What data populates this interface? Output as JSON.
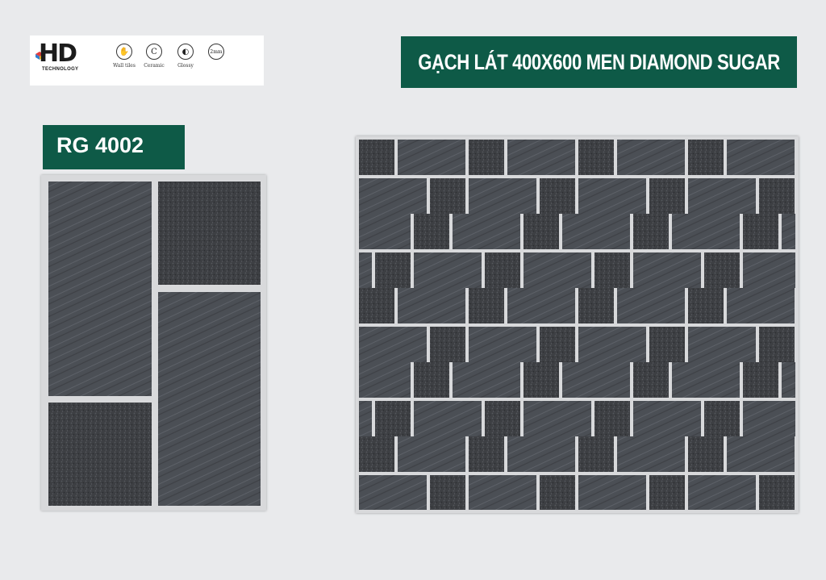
{
  "brand": {
    "logo_text": "HD",
    "logo_subtext": "TECHNOLOGY",
    "features": [
      {
        "icon": "hand-icon",
        "glyph": "✋",
        "label": "Wall tiles"
      },
      {
        "icon": "ceramic-body-icon",
        "glyph": "C",
        "label": "Ceramic"
      },
      {
        "icon": "glossy-icon",
        "glyph": "◐",
        "label": "Glossy"
      },
      {
        "icon": "thickness-icon",
        "glyph": "2mm",
        "label": ""
      }
    ]
  },
  "title": "GẠCH LÁT 400X600 MEN DIAMOND SUGAR",
  "product_code": "RG 4002",
  "colors": {
    "banner_green": "#0e5a47",
    "tile_smooth": "#4b4f55",
    "tile_rough": "#3d3f43",
    "grout": "#d8d9db"
  }
}
